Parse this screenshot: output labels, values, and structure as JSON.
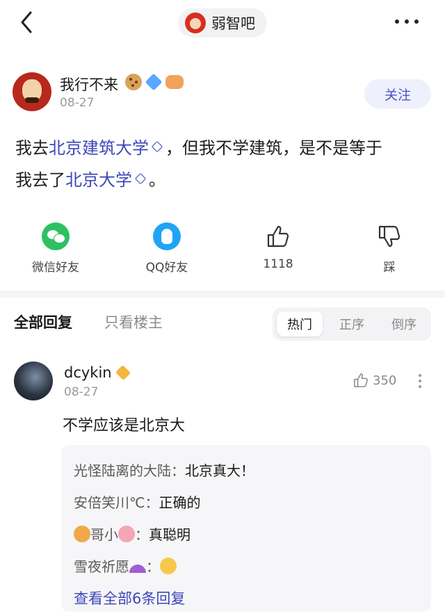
{
  "topbar": {
    "forum_name": "弱智吧"
  },
  "post": {
    "author_name": "我行不来",
    "date": "08-27",
    "follow_label": "关注",
    "content": {
      "p1": "我去",
      "link1": "北京建筑大学",
      "p2": "，但我不学建筑，是不是等于",
      "p3": "我去了",
      "link2": "北京大学",
      "p4": "。"
    }
  },
  "actions": {
    "wechat_label": "微信好友",
    "qq_label": "QQ好友",
    "like_count": "1118",
    "dislike_label": "踩"
  },
  "replies_header": {
    "tab_all": "全部回复",
    "tab_owner": "只看楼主",
    "sort_options": [
      "热门",
      "正序",
      "倒序"
    ],
    "sort_active": "热门"
  },
  "comment": {
    "user": "dcykin",
    "date": "08-27",
    "likes": "350",
    "text": "不学应该是北京大",
    "sub_replies": [
      {
        "user": "光怪陆离的大陆",
        "sep": "：",
        "text": "北京真大！"
      },
      {
        "user": "安倍笑川℃",
        "sep": "：",
        "text": "正确的"
      },
      {
        "user": "哥小",
        "sep": "：",
        "text": "真聪明"
      },
      {
        "user": "雪夜祈愿",
        "sep": "：",
        "text": ""
      }
    ],
    "view_all": "查看全部6条回复"
  },
  "colors": {
    "accent": "#3d47b8",
    "follow_bg": "#eef0fc",
    "wechat": "#2dc162",
    "qq": "#1fa4f5"
  },
  "icons": [
    "back-icon",
    "more-icon",
    "wechat-icon",
    "qq-icon",
    "thumb-up-icon",
    "thumb-down-icon"
  ]
}
